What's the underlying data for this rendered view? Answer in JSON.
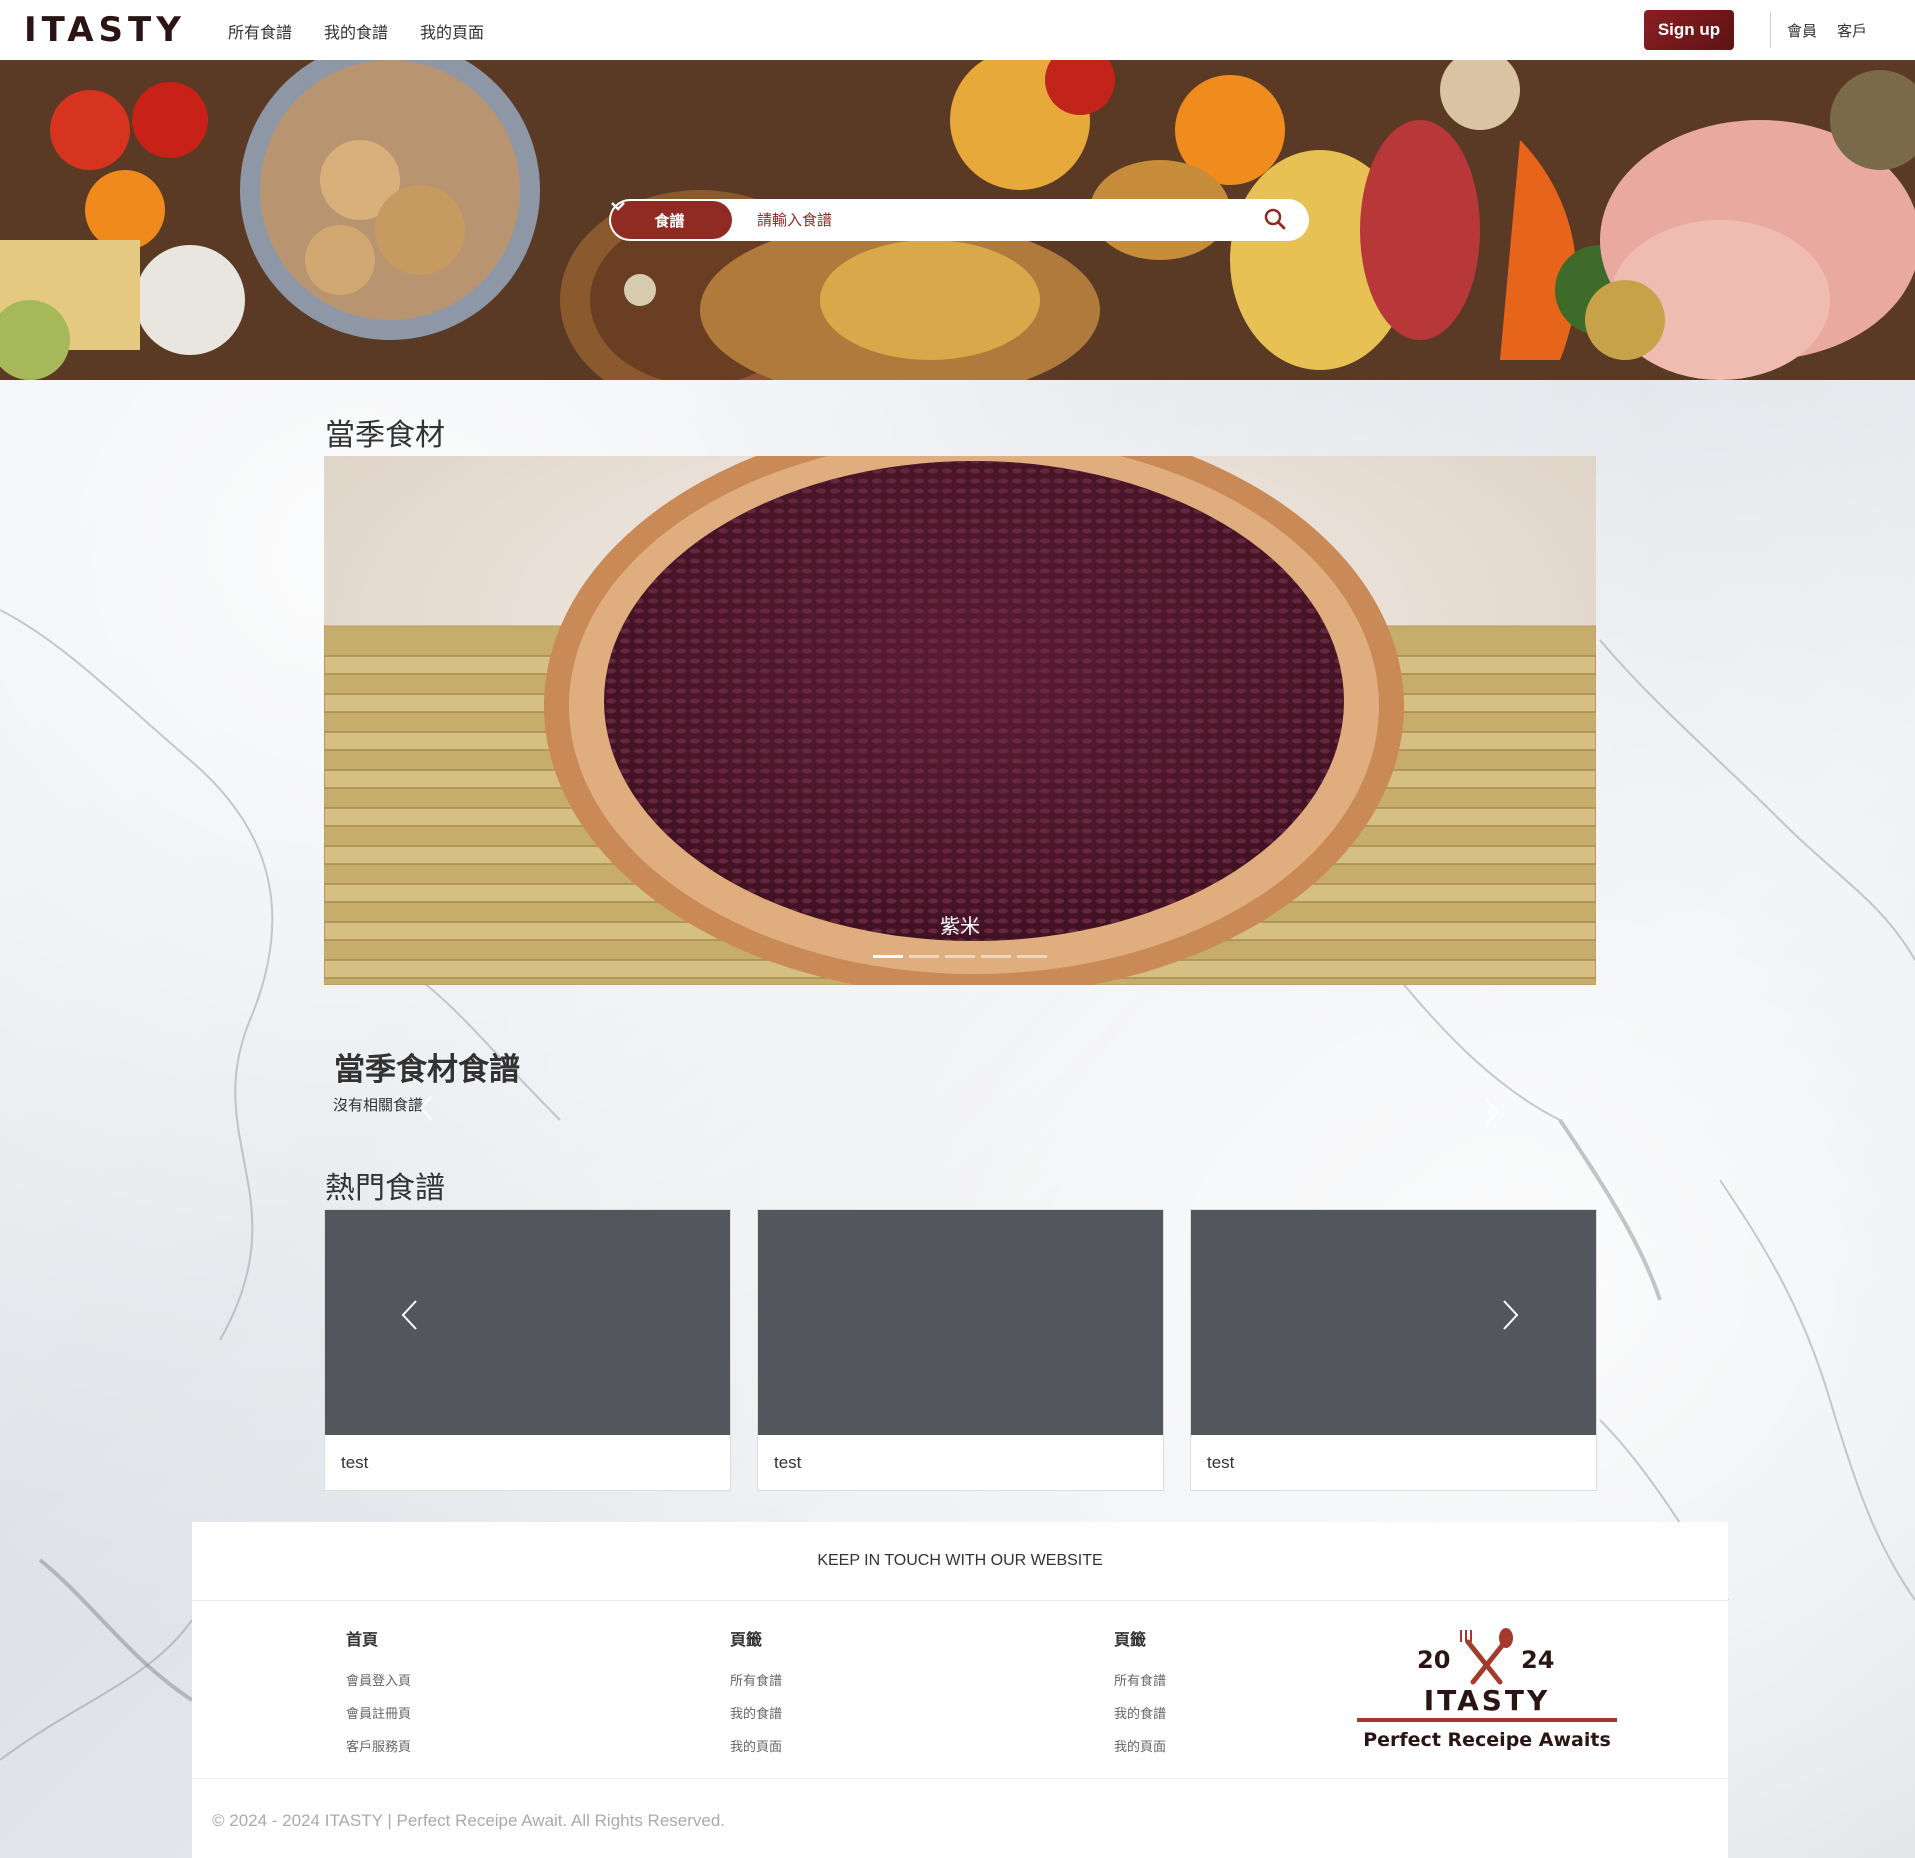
{
  "navbar": {
    "brand": "ITASTY",
    "links": [
      "所有食譜",
      "我的食譜",
      "我的頁面"
    ],
    "signup_label": "Sign up",
    "right_links": [
      "會員",
      "客戶"
    ]
  },
  "search": {
    "category_label": "食譜",
    "placeholder": "請輸入食譜"
  },
  "seasonal": {
    "title": "當季食材",
    "slide_caption": "紫米",
    "indicator_count": 5,
    "active_indicator": 0
  },
  "seasonal_recipes": {
    "title": "當季食材食譜",
    "empty_text": "沒有相關食譜"
  },
  "popular": {
    "title": "熱門食譜",
    "cards": [
      {
        "title": "test"
      },
      {
        "title": "test"
      },
      {
        "title": "test"
      }
    ]
  },
  "footer": {
    "heading": "KEEP IN TOUCH WITH OUR WEBSITE",
    "columns": [
      {
        "title": "首頁",
        "links": [
          "會員登入頁",
          "會員註冊頁",
          "客戶服務頁"
        ]
      },
      {
        "title": "頁籤",
        "links": [
          "所有食譜",
          "我的食譜",
          "我的頁面"
        ]
      },
      {
        "title": "頁籤",
        "links": [
          "所有食譜",
          "我的食譜",
          "我的頁面"
        ]
      }
    ],
    "logo": {
      "year_left": "20",
      "year_right": "24",
      "name": "ITASTY",
      "tagline": "Perfect Receipe Awaits"
    },
    "copyright": "© 2024 - 2024 ITASTY | Perfect Receipe Await. All Rights Reserved."
  },
  "colors": {
    "accent": "#8f2b22",
    "brand_dark": "#2a1416",
    "card_placeholder": "#53565a"
  }
}
